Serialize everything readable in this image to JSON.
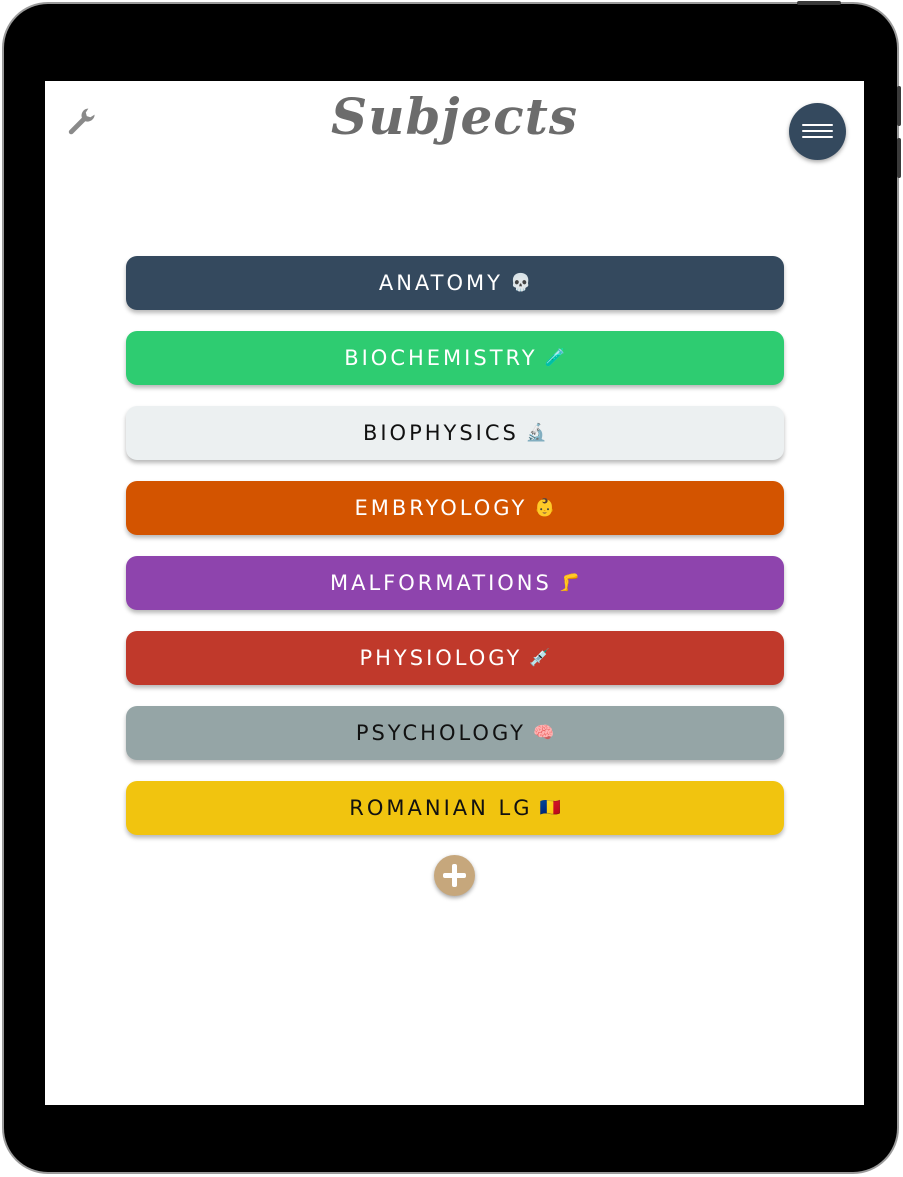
{
  "header": {
    "title": "Subjects",
    "settings_icon": "wrench-icon",
    "menu_icon": "hamburger-menu-icon"
  },
  "subjects": [
    {
      "label": "ANATOMY",
      "emoji": "💀",
      "color": "#34495e",
      "text_color": "#ffffff"
    },
    {
      "label": "BIOCHEMISTRY",
      "emoji": "🧪",
      "color": "#2ecc71",
      "text_color": "#ffffff"
    },
    {
      "label": "BIOPHYSICS",
      "emoji": "🔬",
      "color": "#ecf0f1",
      "text_color": "#111111"
    },
    {
      "label": "EMBRYOLOGY",
      "emoji": "👶",
      "color": "#d35400",
      "text_color": "#ffffff"
    },
    {
      "label": "MALFORMATIONS",
      "emoji": "🦵",
      "color": "#8e44ad",
      "text_color": "#ffffff"
    },
    {
      "label": "PHYSIOLOGY",
      "emoji": "💉",
      "color": "#c0392b",
      "text_color": "#ffffff"
    },
    {
      "label": "PSYCHOLOGY",
      "emoji": "🧠",
      "color": "#95a5a6",
      "text_color": "#111111"
    },
    {
      "label": "ROMANIAN LG",
      "emoji": "🇷🇴",
      "color": "#f1c40f",
      "text_color": "#111111"
    }
  ],
  "add_button": {
    "icon": "plus-icon",
    "color": "#c6a77c"
  }
}
